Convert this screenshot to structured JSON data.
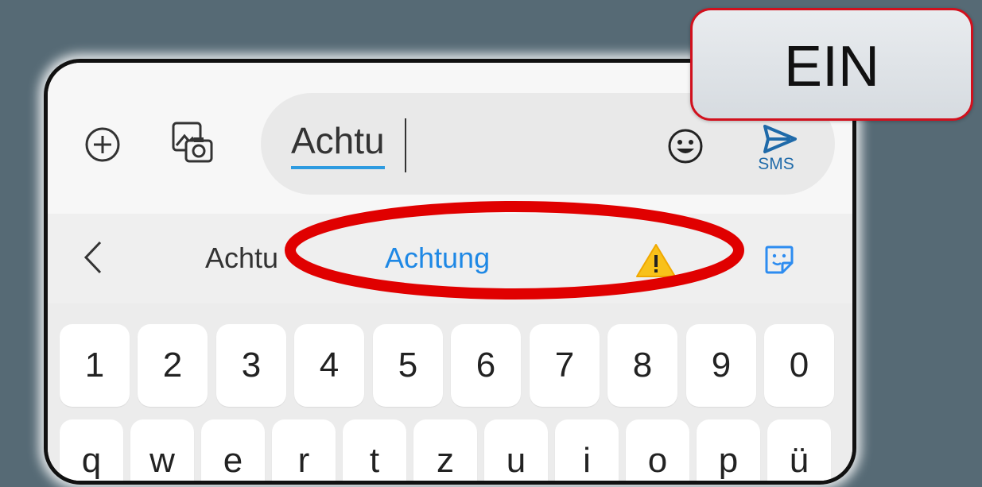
{
  "input_bar": {
    "text_value": "Achtu",
    "send_label": "SMS"
  },
  "suggestions": {
    "items": [
      "Achtu",
      "Achtung"
    ],
    "emoji_suggestion": "warning-sign-emoji"
  },
  "keyboard": {
    "number_row": [
      "1",
      "2",
      "3",
      "4",
      "5",
      "6",
      "7",
      "8",
      "9",
      "0"
    ],
    "letter_row": [
      "q",
      "w",
      "e",
      "r",
      "t",
      "z",
      "u",
      "i",
      "o",
      "p",
      "ü"
    ]
  },
  "annotation": {
    "label": "EIN",
    "highlight_color": "#e00000"
  },
  "colors": {
    "accent": "#1e88e5",
    "send_icon": "#1f6aa9",
    "background": "#566a75"
  }
}
